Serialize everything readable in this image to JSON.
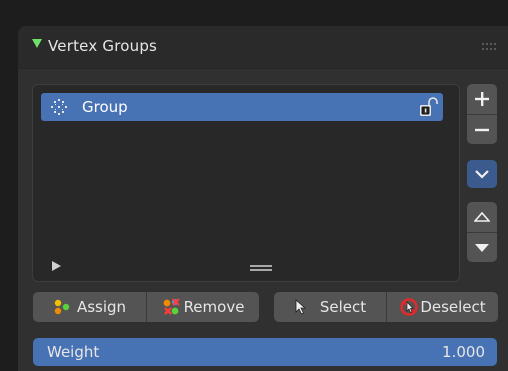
{
  "panel": {
    "title": "Vertex Groups",
    "collapse_icon": "triangle-down-icon",
    "grip_icon": "drag-grip-icon"
  },
  "vertex_group_list": {
    "items": [
      {
        "name": "Group",
        "icon": "vertex-group-icon",
        "selected": true,
        "lock_icon": "unlocked-padlock-icon"
      }
    ],
    "expand_icon": "triangle-right-icon",
    "resize_icon": "resize-grip-icon"
  },
  "side_buttons": {
    "add": {
      "label": "+",
      "icon": "plus-icon"
    },
    "remove": {
      "label": "−",
      "icon": "minus-icon"
    },
    "specials": {
      "icon": "chevron-down-icon"
    },
    "move_up": {
      "icon": "triangle-up-icon"
    },
    "move_down": {
      "icon": "triangle-down-icon"
    }
  },
  "actions": {
    "assign": {
      "label": "Assign",
      "icon": "assign-vertices-icon"
    },
    "remove": {
      "label": "Remove",
      "icon": "remove-vertices-icon"
    },
    "select": {
      "label": "Select",
      "icon": "cursor-arrow-icon"
    },
    "deselect": {
      "label": "Deselect",
      "icon": "deselect-cursor-icon"
    }
  },
  "weight": {
    "label": "Weight",
    "value": "1.000"
  },
  "colors": {
    "selection_blue": "#4772b3",
    "panel_bg": "#303030",
    "header_bg": "#2a2a2a",
    "button_bg": "#545454",
    "collapse_arrow_green": "#6fe06c",
    "deselect_red": "#e02a2a"
  }
}
